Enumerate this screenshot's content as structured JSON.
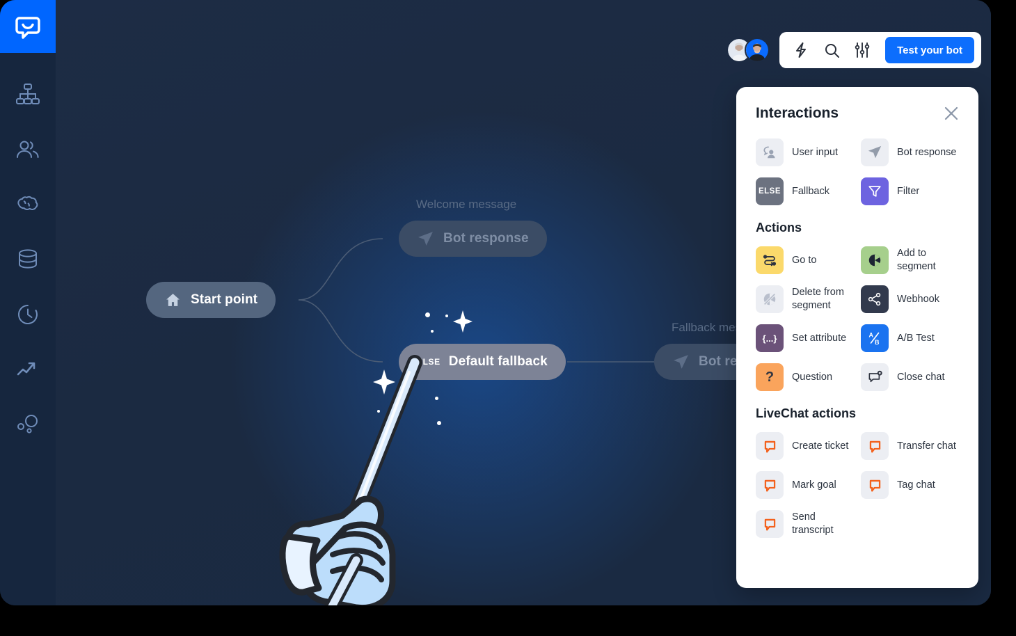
{
  "app": {
    "name": "ChatBot",
    "logo_icon": "chatbot-logo-icon"
  },
  "sidebar": {
    "items": [
      {
        "name": "stories",
        "icon": "flow-chart-icon"
      },
      {
        "name": "users",
        "icon": "users-icon"
      },
      {
        "name": "training",
        "icon": "brain-icon"
      },
      {
        "name": "knowledge-base",
        "icon": "database-icon"
      },
      {
        "name": "history",
        "icon": "clock-history-icon"
      },
      {
        "name": "analytics",
        "icon": "trending-up-icon"
      },
      {
        "name": "segments",
        "icon": "bubbles-icon"
      }
    ]
  },
  "topbar": {
    "avatars": [
      {
        "name": "avatar-user-1"
      },
      {
        "name": "avatar-user-2"
      }
    ],
    "tools": [
      {
        "name": "lightning-icon"
      },
      {
        "name": "search-icon"
      },
      {
        "name": "sliders-icon"
      }
    ],
    "test_button_label": "Test your bot",
    "accent_color": "#0d6efd"
  },
  "canvas": {
    "nodes": [
      {
        "name": "start-point",
        "label": "Start point",
        "icon": "home-icon",
        "title": ""
      },
      {
        "name": "welcome-bot-response",
        "label": "Bot response",
        "icon": "send-icon",
        "title": "Welcome message"
      },
      {
        "name": "default-fallback",
        "label": "Default fallback",
        "chip": "ELSE",
        "title": ""
      },
      {
        "name": "fallback-bot-response",
        "label": "Bot response",
        "icon": "send-icon",
        "title": "Fallback message"
      }
    ],
    "cursor": {
      "name": "magic-wand-hand",
      "icon": "hand-wand-icon"
    }
  },
  "panel": {
    "title": "Interactions",
    "close_label": "×",
    "sections": [
      {
        "title": "",
        "items": [
          {
            "label": "User input",
            "icon": "user-input-icon",
            "tile": "tile-grey"
          },
          {
            "label": "Bot response",
            "icon": "send-icon",
            "tile": "tile-grey"
          },
          {
            "label": "Fallback",
            "icon": "else-text-icon",
            "tile": "tile-slate",
            "text": "ELSE"
          },
          {
            "label": "Filter",
            "icon": "funnel-icon",
            "tile": "tile-purple"
          }
        ]
      },
      {
        "title": "Actions",
        "items": [
          {
            "label": "Go to",
            "icon": "route-icon",
            "tile": "tile-yellow"
          },
          {
            "label": "Add to segment",
            "icon": "pie-chart-icon",
            "tile": "tile-green"
          },
          {
            "label": "Delete from segment",
            "icon": "pie-chart-off-icon",
            "tile": "tile-grey"
          },
          {
            "label": "Webhook",
            "icon": "share-nodes-icon",
            "tile": "tile-dark"
          },
          {
            "label": "Set attribute",
            "icon": "braces-icon",
            "tile": "tile-plum",
            "text": "{...}"
          },
          {
            "label": "A/B Test",
            "icon": "ab-test-icon",
            "tile": "tile-blue"
          },
          {
            "label": "Question",
            "icon": "question-mark-icon",
            "tile": "tile-orange",
            "text": "?"
          },
          {
            "label": "Close chat",
            "icon": "chat-close-icon",
            "tile": "tile-grey"
          }
        ]
      },
      {
        "title": "LiveChat actions",
        "items": [
          {
            "label": "Create ticket",
            "icon": "livechat-icon",
            "tile": "tile-grey"
          },
          {
            "label": "Transfer chat",
            "icon": "livechat-icon",
            "tile": "tile-grey"
          },
          {
            "label": "Mark goal",
            "icon": "livechat-icon",
            "tile": "tile-grey"
          },
          {
            "label": "Tag chat",
            "icon": "livechat-icon",
            "tile": "tile-grey"
          },
          {
            "label": "Send transcript",
            "icon": "livechat-icon",
            "tile": "tile-grey"
          }
        ]
      }
    ]
  }
}
